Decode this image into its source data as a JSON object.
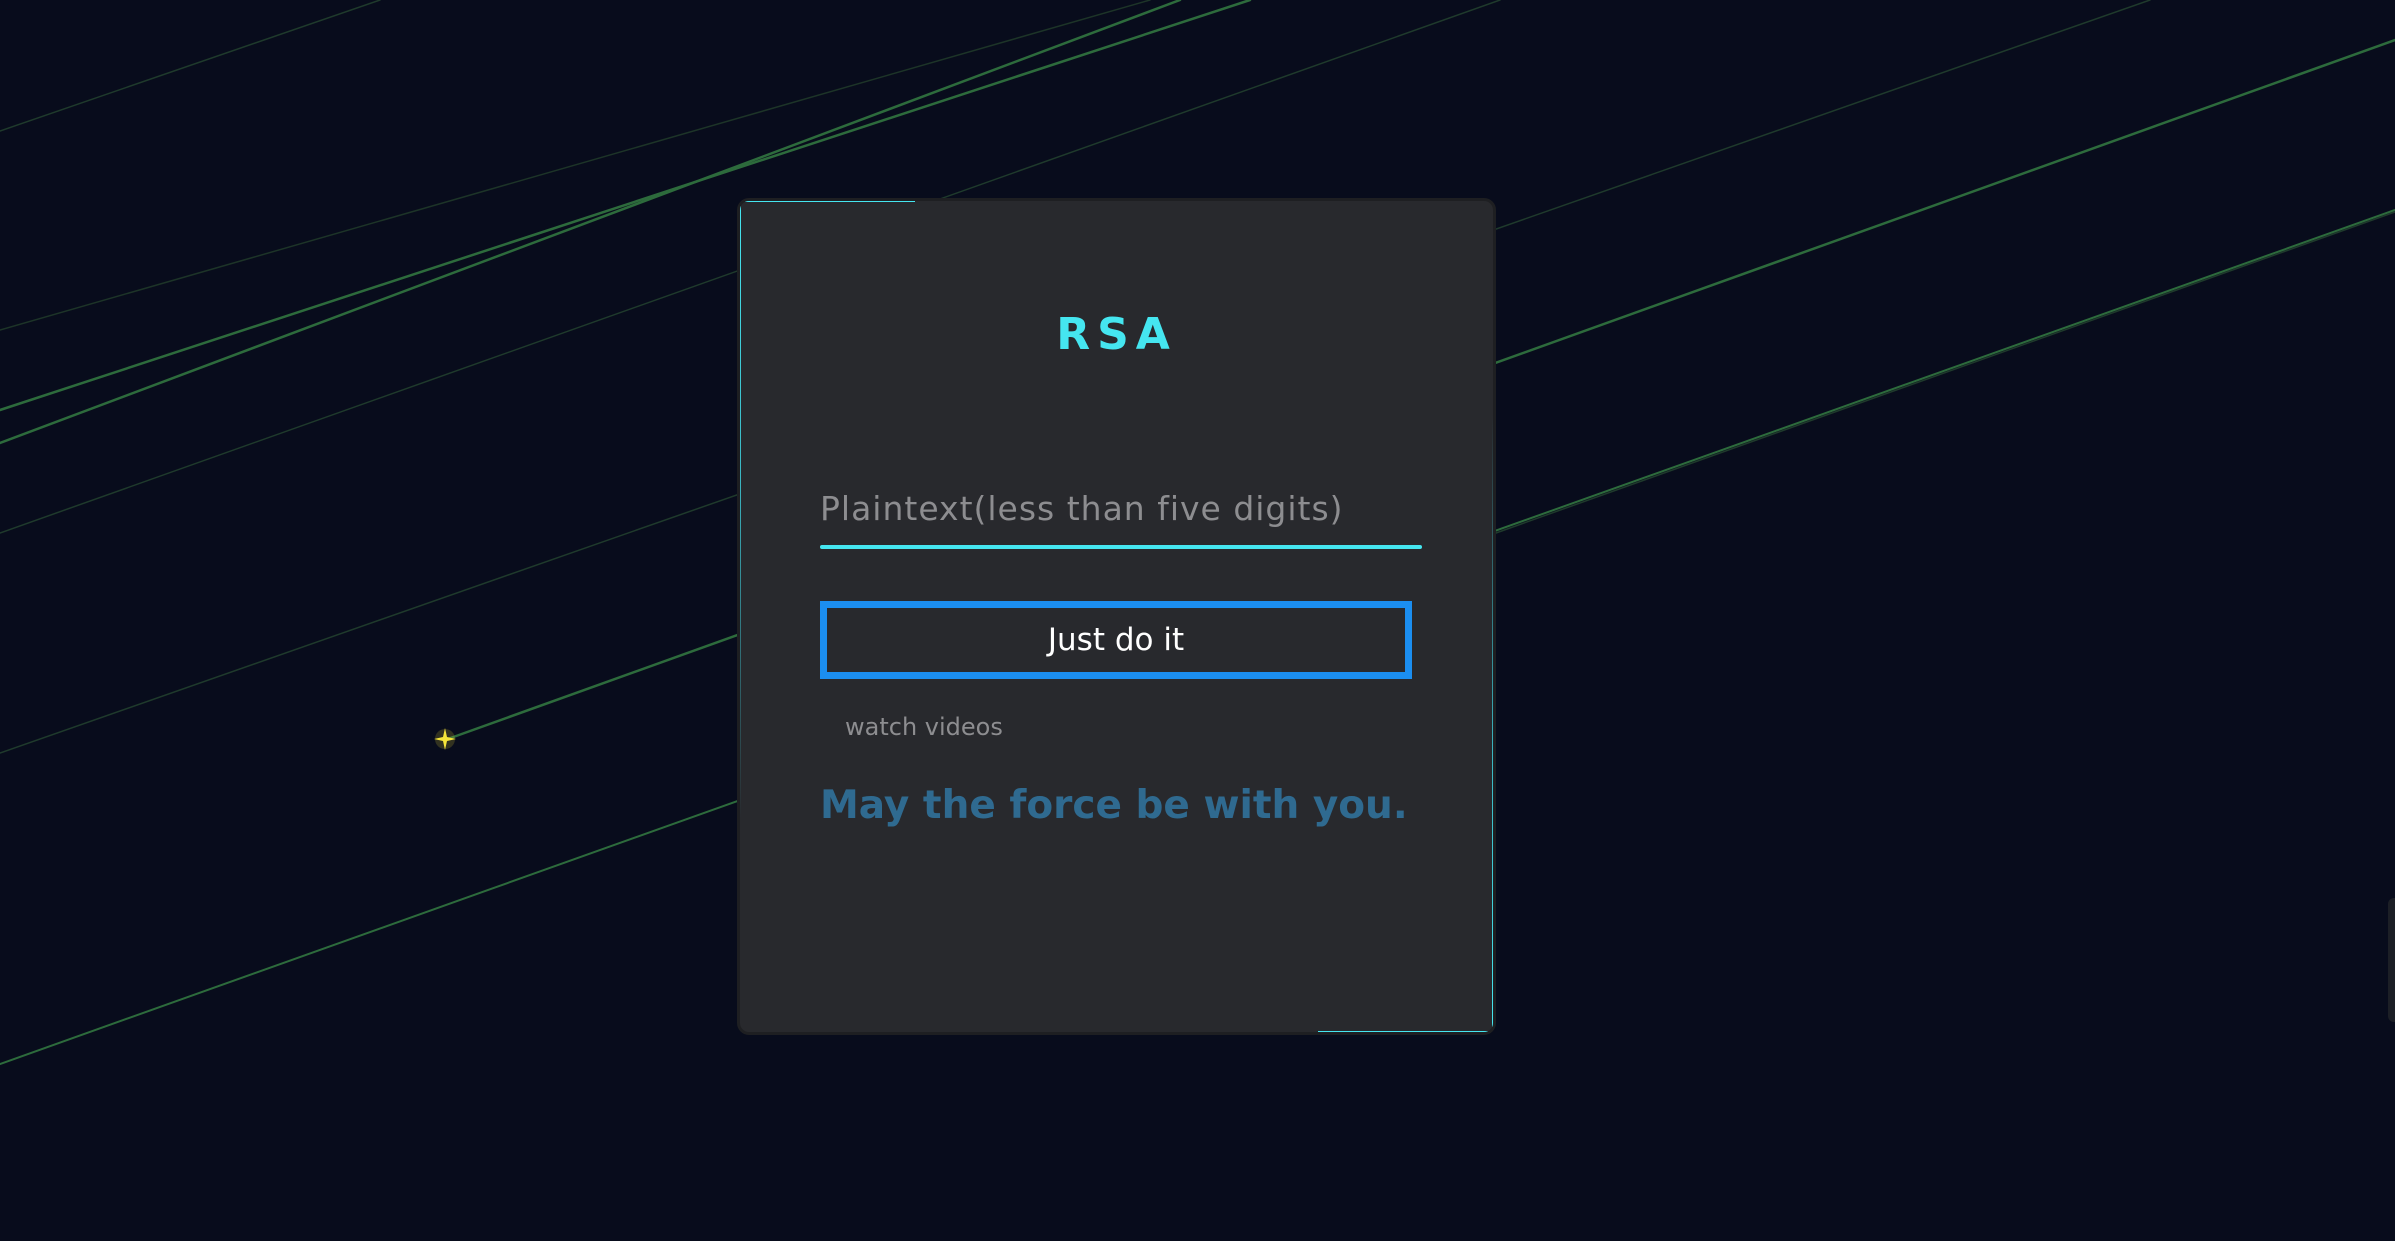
{
  "app": {
    "title": "RSA"
  },
  "form": {
    "plaintext_placeholder": "Plaintext(less than five digits)",
    "plaintext_value": "",
    "submit_label": "Just do it",
    "link_label": "watch videos",
    "message": "May the force be with you."
  },
  "colors": {
    "background": "#080c1c",
    "card": "#28292d",
    "accent_cyan": "#45e6f0",
    "button_border": "#1b8ef0",
    "message_text": "#2f6a90",
    "line_green": "#2d6b3c",
    "star": "#f5e53a"
  },
  "icons": {
    "star": "sparkle-star-icon"
  }
}
